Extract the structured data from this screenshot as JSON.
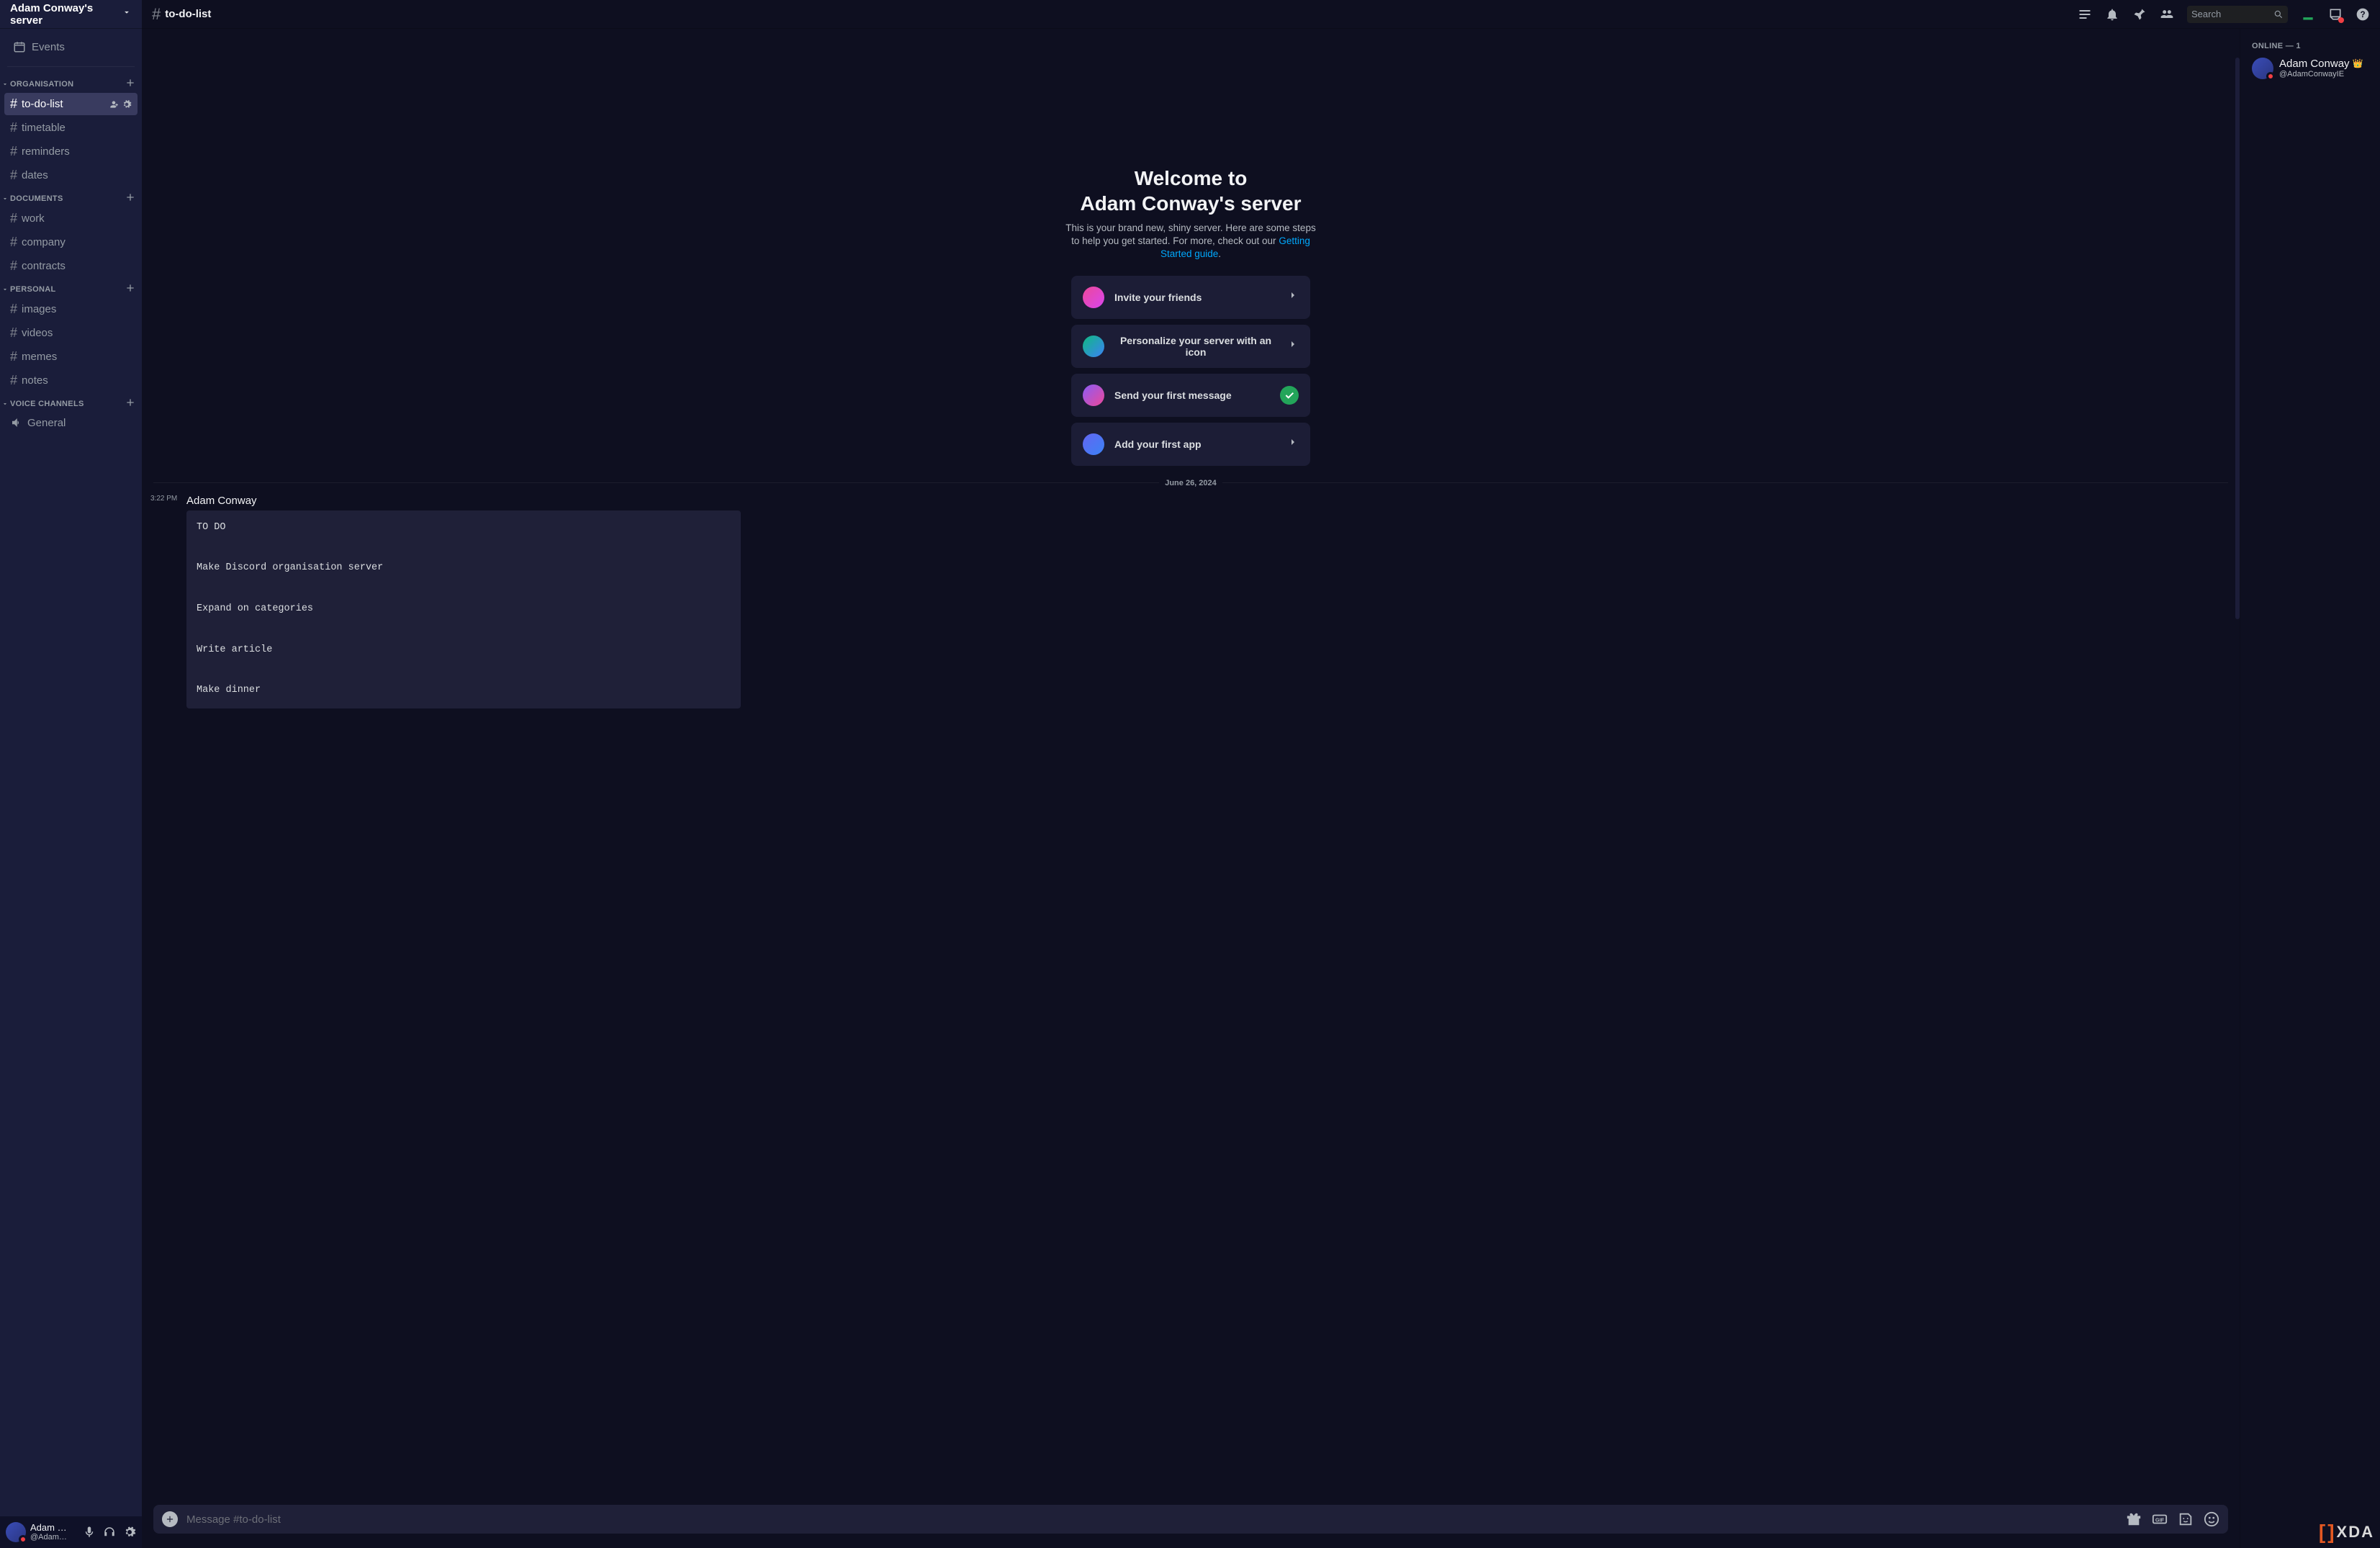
{
  "server": {
    "name": "Adam Conway's server"
  },
  "sidebar": {
    "events": "Events",
    "categories": [
      {
        "name": "ORGANISATION",
        "channels": [
          "to-do-list",
          "timetable",
          "reminders",
          "dates"
        ],
        "active": 0
      },
      {
        "name": "DOCUMENTS",
        "channels": [
          "work",
          "company",
          "contracts"
        ],
        "active": -1
      },
      {
        "name": "PERSONAL",
        "channels": [
          "images",
          "videos",
          "memes",
          "notes"
        ],
        "active": -1
      },
      {
        "name": "VOICE CHANNELS",
        "voice": [
          "General"
        ]
      }
    ]
  },
  "user_panel": {
    "name": "Adam Con...",
    "tag": "@AdamCon..."
  },
  "topbar": {
    "channel": "to-do-list",
    "search_placeholder": "Search"
  },
  "welcome": {
    "line1": "Welcome to",
    "line2": "Adam Conway's server",
    "desc_pre": "This is your brand new, shiny server. Here are some steps to help you get started. For more, check out our ",
    "desc_link": "Getting Started guide",
    "desc_post": ".",
    "cards": [
      {
        "label": "Invite your friends",
        "done": false,
        "color": "linear-gradient(135deg,#ec4899,#d946ef)"
      },
      {
        "label": "Personalize your server with an icon",
        "done": false,
        "color": "linear-gradient(135deg,#10b981,#3b82f6)"
      },
      {
        "label": "Send your first message",
        "done": true,
        "color": "linear-gradient(135deg,#8b5cf6,#ec4899)"
      },
      {
        "label": "Add your first app",
        "done": false,
        "color": "linear-gradient(135deg,#6366f1,#3b82f6)"
      }
    ]
  },
  "date_divider": "June 26, 2024",
  "message": {
    "time": "3:22 PM",
    "author": "Adam Conway",
    "code": "TO DO\n\nMake Discord organisation server\n\nExpand on categories\n\nWrite article\n\nMake dinner"
  },
  "composer": {
    "placeholder": "Message #to-do-list"
  },
  "members": {
    "header": "ONLINE — 1",
    "list": [
      {
        "name": "Adam Conway",
        "tag": "@AdamConwayIE",
        "owner": true
      }
    ]
  },
  "brand": {
    "text": "XDA"
  }
}
